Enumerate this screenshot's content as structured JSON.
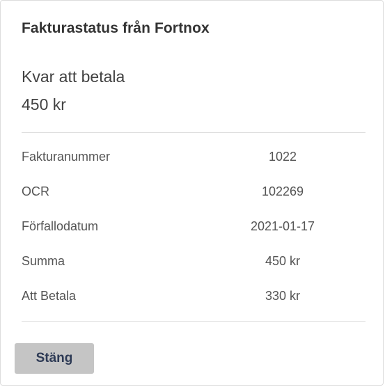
{
  "dialog": {
    "title": "Fakturastatus från Fortnox",
    "remaining_label": "Kvar att betala",
    "remaining_value": "450 kr",
    "rows": [
      {
        "label": "Fakturanummer",
        "value": "1022"
      },
      {
        "label": "OCR",
        "value": "102269"
      },
      {
        "label": "Förfallodatum",
        "value": "2021-01-17"
      },
      {
        "label": "Summa",
        "value": "450 kr"
      },
      {
        "label": "Att Betala",
        "value": "330 kr"
      }
    ],
    "close_label": "Stäng"
  }
}
